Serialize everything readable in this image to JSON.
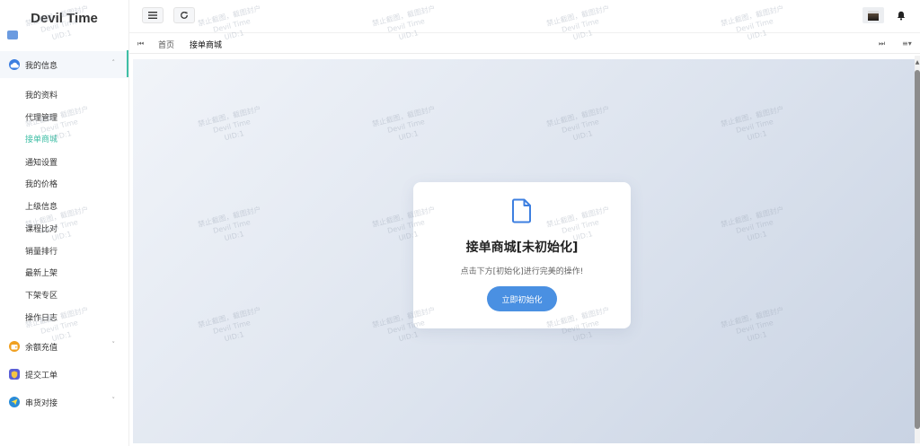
{
  "app": {
    "title": "Devil Time"
  },
  "sidebar": {
    "groups": [
      {
        "label": "我的信息",
        "icon": "cloud-icon",
        "expanded": true
      },
      {
        "label": "余额充值",
        "icon": "wallet-icon"
      },
      {
        "label": "提交工单",
        "icon": "shield-icon"
      },
      {
        "label": "串货对接",
        "icon": "send-icon"
      }
    ],
    "items": [
      {
        "label": "我的资料"
      },
      {
        "label": "代理管理"
      },
      {
        "label": "接单商城",
        "current": true
      },
      {
        "label": "通知设置"
      },
      {
        "label": "我的价格"
      },
      {
        "label": "上级信息"
      },
      {
        "label": "课程比对"
      },
      {
        "label": "销量排行"
      },
      {
        "label": "最新上架"
      },
      {
        "label": "下架专区"
      },
      {
        "label": "操作日志"
      }
    ]
  },
  "header": {
    "menu_icon": "hamburger-icon",
    "refresh_icon": "refresh-icon",
    "bell_icon": "bell-icon"
  },
  "tabs": {
    "items": [
      {
        "label": "首页"
      },
      {
        "label": "接单商城",
        "current": true
      }
    ]
  },
  "card": {
    "title": "接单商城[未初始化]",
    "description": "点击下方[初始化]进行完美的操作!",
    "button_label": "立即初始化",
    "icon": "document-icon"
  },
  "watermark": {
    "line1": "禁止截图，截图封户",
    "line2": "Devil Time",
    "line3": "UID:1"
  },
  "colors": {
    "accent": "#3fbfa6",
    "primary_button": "#4a90e2"
  }
}
